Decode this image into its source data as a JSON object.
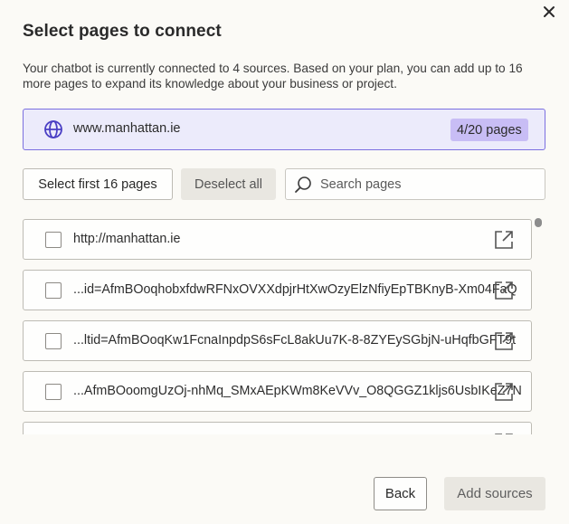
{
  "modal": {
    "title": "Select pages to connect",
    "description": "Your chatbot is currently connected to 4 sources. Based on your plan, you can add up to 16 more pages to expand its knowledge about your business or project."
  },
  "domain": {
    "url": "www.manhattan.ie",
    "page_count": "4/20 pages",
    "icon": "globe-icon",
    "accent_color": "#7b6fe0",
    "badge_color": "#c8bdf5"
  },
  "toolbar": {
    "select_first_label": "Select first 16 pages",
    "deselect_all_label": "Deselect all",
    "search_placeholder": "Search pages"
  },
  "pages": [
    {
      "url": "http://manhattan.ie",
      "checked": false
    },
    {
      "url": "...id=AfmBOoqhobxfdwRFNxOVXXdpjrHtXwOzyElzNfiyEpTBKnyB-Xm04FaQ",
      "checked": false
    },
    {
      "url": "...ltid=AfmBOoqKw1FcnaInpdpS6sFcL8akUu7K-8-8ZYEySGbjN-uHqfbGFT9t",
      "checked": false
    },
    {
      "url": "...AfmBOoomgUzOj-nhMq_SMxAEpKWm8KeVVv_O8QGGZ1kljs6UsbIKeZ7N",
      "checked": false
    }
  ],
  "footer": {
    "back_label": "Back",
    "add_sources_label": "Add sources"
  }
}
